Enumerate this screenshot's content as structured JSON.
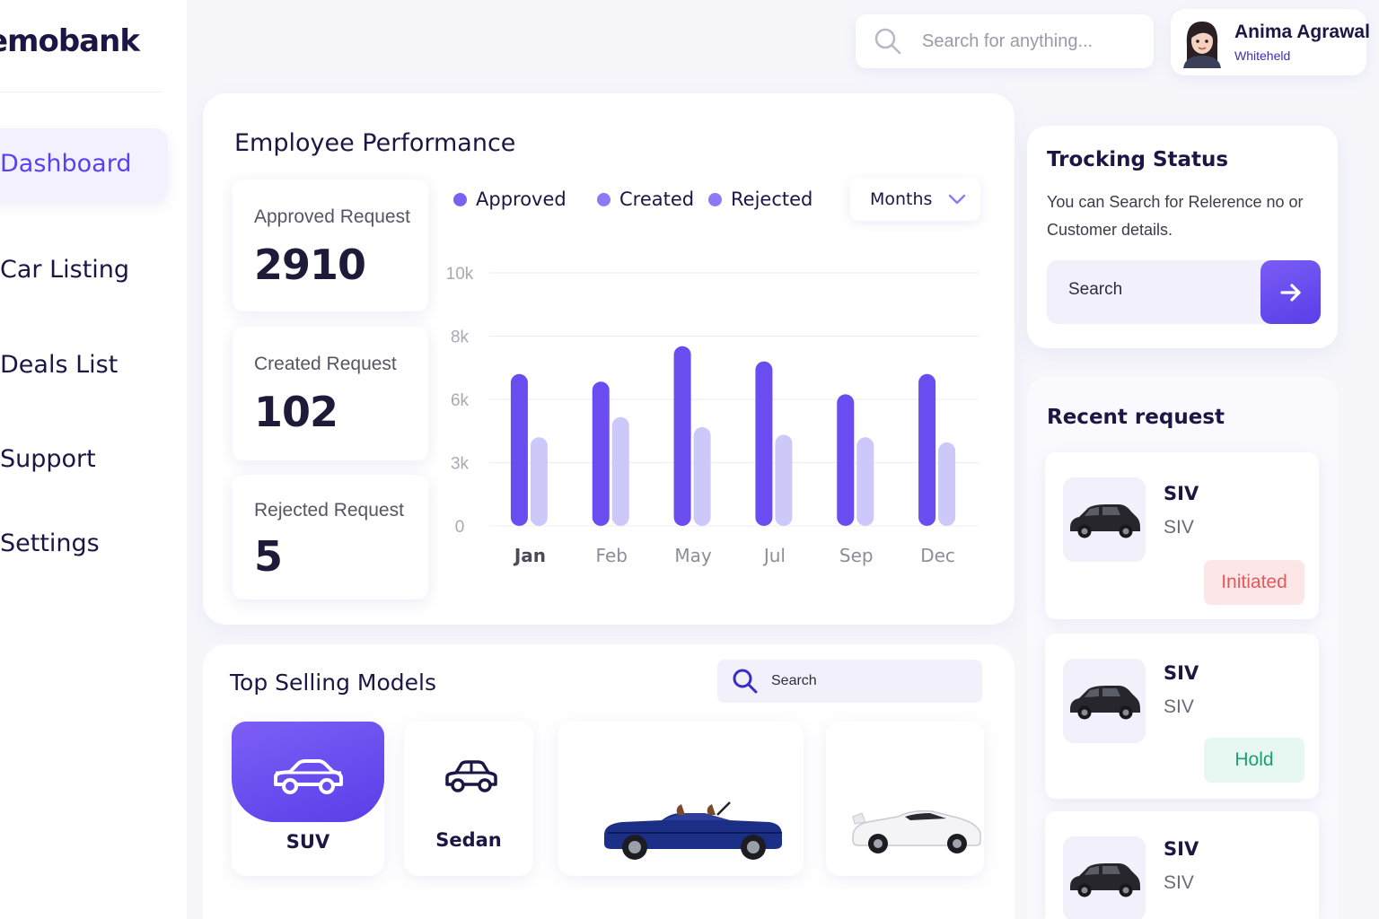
{
  "brand": {
    "name": "emobank"
  },
  "sidebar": {
    "items": [
      {
        "label": "Dashboard",
        "active": true
      },
      {
        "label": "Car Listing"
      },
      {
        "label": "Deals List"
      },
      {
        "label": "Support"
      },
      {
        "label": "Settings"
      }
    ]
  },
  "header": {
    "search_placeholder": "Search for anything...",
    "user": {
      "name": "Anima Agrawal",
      "subtitle": "Whiteheld"
    }
  },
  "performance": {
    "title": "Employee Performance",
    "stats": [
      {
        "label": "Approved Request",
        "value": "2910"
      },
      {
        "label": "Created Request",
        "value": "102"
      },
      {
        "label": "Rejected Request",
        "value": "5"
      }
    ],
    "legend": [
      {
        "label": "Approved",
        "color": "#7b61f0"
      },
      {
        "label": "Created",
        "color": "#8f78f3"
      },
      {
        "label": "Rejected",
        "color": "#8f78f3"
      }
    ],
    "period_select": "Months"
  },
  "chart_data": {
    "type": "bar",
    "categories": [
      "Jan",
      "Feb",
      "May",
      "Jul",
      "Sep",
      "Dec"
    ],
    "y_ticks": [
      "10k",
      "8k",
      "6k",
      "3k",
      "0"
    ],
    "ylim": [
      0,
      10000
    ],
    "series": [
      {
        "color": "#6a4cf0",
        "values": [
          6000,
          5700,
          7100,
          6500,
          5200,
          6000
        ]
      },
      {
        "color": "#cdc8fa",
        "values": [
          3500,
          4300,
          3900,
          3600,
          3500,
          3300
        ]
      }
    ],
    "grid": true,
    "active_category": "Jan"
  },
  "tracking": {
    "title": "Trocking Status",
    "description": "You can Search for Relerence no or Customer details.",
    "search_placeholder": "Search"
  },
  "recent": {
    "title": "Recent request",
    "items": [
      {
        "title": "SIV",
        "subtitle": "SIV",
        "status": "Initiated",
        "status_color": "#e8585a",
        "status_bg": "#fde6e7"
      },
      {
        "title": "SIV",
        "subtitle": "SIV",
        "status": "Hold",
        "status_color": "#1e9e78",
        "status_bg": "#e6f8f1"
      },
      {
        "title": "SIV",
        "subtitle": "SIV"
      }
    ]
  },
  "top_selling": {
    "title": "Top Selling Models",
    "search_placeholder": "Search",
    "models": [
      {
        "label": "SUV",
        "selected": true,
        "icon": "car-icon"
      },
      {
        "label": "Sedan",
        "icon": "car-outline-icon"
      },
      {
        "label": "",
        "icon": "blue-convertible-image"
      },
      {
        "label": "",
        "icon": "white-sportscar-image"
      }
    ]
  },
  "colors": {
    "accent": "#5b3ff2",
    "navy": "#1a1745"
  }
}
